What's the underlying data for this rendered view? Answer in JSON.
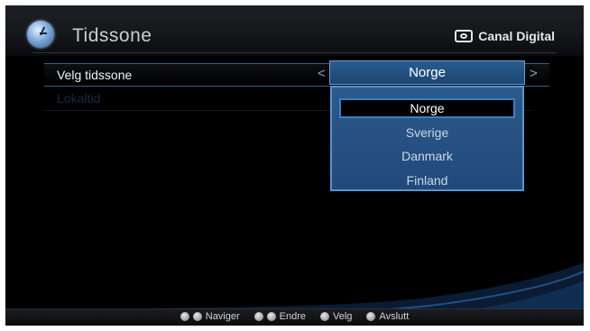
{
  "header": {
    "title": "Tidssone",
    "brand": "Canal Digital"
  },
  "menu": {
    "items": [
      {
        "label": "Velg tidssone",
        "value": "Norge"
      },
      {
        "label": "Lokaltid"
      }
    ]
  },
  "dropdown": {
    "options": [
      "Norge",
      "Sverige",
      "Danmark",
      "Finland"
    ],
    "selected": "Norge"
  },
  "footer": {
    "hints": [
      {
        "label": "Naviger",
        "icons": [
          "up-button-icon",
          "down-button-icon"
        ]
      },
      {
        "label": "Endre",
        "icons": [
          "left-button-icon",
          "right-button-icon"
        ]
      },
      {
        "label": "Velg",
        "icons": [
          "ok-button-icon"
        ]
      },
      {
        "label": "Avslutt",
        "icons": [
          "tv-button-icon"
        ]
      }
    ]
  },
  "colors": {
    "accent": "#2a5b8f",
    "highlight_border": "#5e92cc"
  }
}
